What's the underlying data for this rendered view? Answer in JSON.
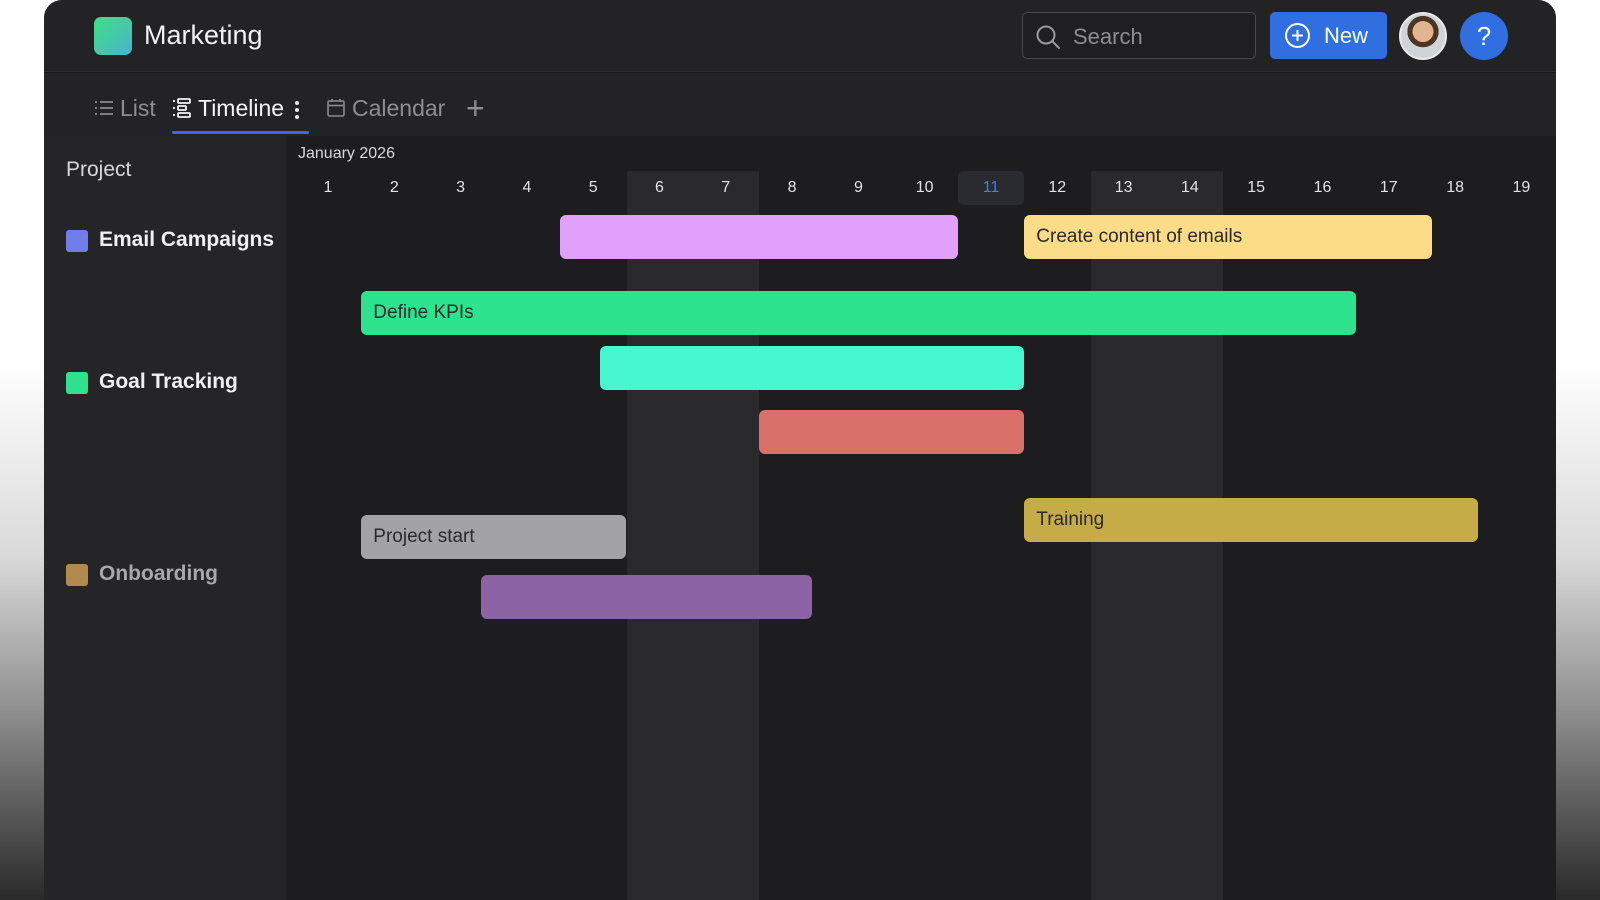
{
  "header": {
    "app_title": "Marketing",
    "search_placeholder": "Search",
    "new_button_label": "New",
    "help_label": "?"
  },
  "tabs": [
    {
      "label": "List",
      "icon": "list-icon",
      "active": false
    },
    {
      "label": "Timeline",
      "icon": "timeline-icon",
      "active": true
    },
    {
      "label": "Calendar",
      "icon": "calendar-icon",
      "active": false
    }
  ],
  "add_view_label": "+",
  "sidebar": {
    "header": "Project",
    "projects": [
      {
        "name": "Email Campaigns",
        "color": "#6f7ee8"
      },
      {
        "name": "Goal Tracking",
        "color": "#2ee38d"
      },
      {
        "name": "Onboarding",
        "color": "#b08a4e"
      }
    ]
  },
  "timeline": {
    "month_label": "January 2026",
    "days": [
      "1",
      "2",
      "3",
      "4",
      "5",
      "6",
      "7",
      "8",
      "9",
      "10",
      "11",
      "12",
      "13",
      "14",
      "15",
      "16",
      "17",
      "18",
      "19"
    ],
    "today": "11",
    "weekend_days": [
      [
        "6",
        "7"
      ],
      [
        "13",
        "14"
      ]
    ],
    "tasks": [
      {
        "label": "",
        "color": "#e0a0fb",
        "start_day": 4.5,
        "end_day": 10.5,
        "project": "Email Campaigns"
      },
      {
        "label": "Create content of emails",
        "color": "#fcdc86",
        "start_day": 11.5,
        "end_day": 17.65,
        "project": "Email Campaigns"
      },
      {
        "label": "Define KPIs",
        "color": "#2ee38d",
        "start_day": 1.5,
        "end_day": 16.5,
        "project": "Goal Tracking"
      },
      {
        "label": "",
        "color": "#46f7cf",
        "start_day": 5.1,
        "end_day": 11.5,
        "project": "Goal Tracking"
      },
      {
        "label": "",
        "color": "#d9706a",
        "start_day": 7.5,
        "end_day": 11.5,
        "project": "Goal Tracking"
      },
      {
        "label": "Training",
        "color": "#c5ac46",
        "start_day": 11.5,
        "end_day": 18.35,
        "project": "Onboarding"
      },
      {
        "label": "Project start",
        "color": "#a3a3a6",
        "start_day": 1.5,
        "end_day": 5.5,
        "project": "Onboarding"
      },
      {
        "label": "",
        "color": "#8c64a5",
        "start_day": 3.3,
        "end_day": 8.3,
        "project": "Onboarding"
      }
    ]
  }
}
